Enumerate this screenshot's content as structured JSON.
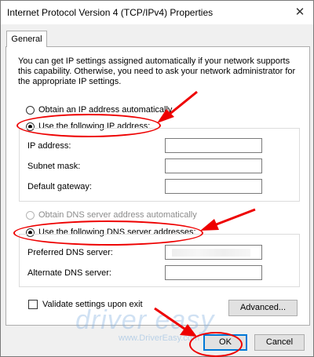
{
  "window": {
    "title": "Internet Protocol Version 4 (TCP/IPv4) Properties",
    "close_glyph": "✕"
  },
  "tabs": [
    {
      "label": "General"
    }
  ],
  "description": "You can get IP settings assigned automatically if your network supports this capability. Otherwise, you need to ask your network administrator for the appropriate IP settings.",
  "ip_section": {
    "auto_label": "Obtain an IP address automatically",
    "manual_label": "Use the following IP address:",
    "selected": "manual",
    "fields": [
      {
        "label": "IP address:",
        "value": ""
      },
      {
        "label": "Subnet mask:",
        "value": ""
      },
      {
        "label": "Default gateway:",
        "value": ""
      }
    ]
  },
  "dns_section": {
    "auto_label": "Obtain DNS server address automatically",
    "manual_label": "Use the following DNS server addresses:",
    "selected": "manual",
    "fields": [
      {
        "label": "Preferred DNS server:",
        "value": ""
      },
      {
        "label": "Alternate DNS server:",
        "value": ""
      }
    ]
  },
  "validate_label": "Validate settings upon exit",
  "buttons": {
    "advanced": "Advanced...",
    "ok": "OK",
    "cancel": "Cancel"
  },
  "watermark": {
    "brand": "driver easy",
    "url": "www.DriverEasy.com"
  },
  "annotation_color": "#e00000",
  "icons": {
    "close": "close-icon",
    "arrow": "red-arrow-icon"
  }
}
